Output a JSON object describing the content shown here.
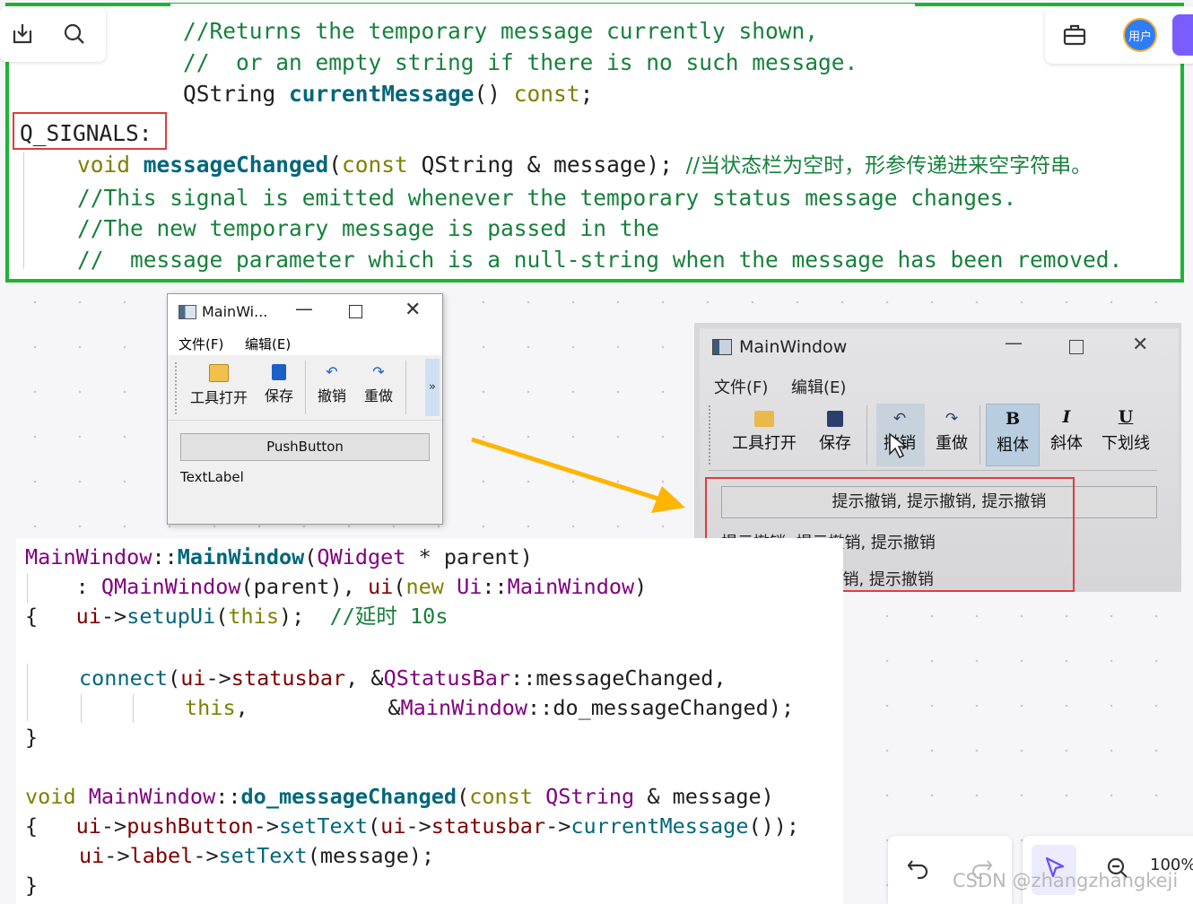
{
  "toolbar_left": {
    "icons": [
      "import-icon",
      "search-icon"
    ]
  },
  "toolbar_right": {
    "avatar_label": "用户"
  },
  "top_code": {
    "line1": "//Returns the temporary message currently shown,",
    "line2": "//  or an empty string if there is no such message.",
    "line3_type": "QString ",
    "line3_fn": "currentMessage",
    "line3_rest": "() ",
    "line3_const": "const",
    "line3_end": ";",
    "signals": "Q_SIGNALS:",
    "sig_void": "void ",
    "sig_fn": "messageChanged",
    "sig_paren": "(",
    "sig_const": "const",
    "sig_params": " QString & message); ",
    "sig_comment": "//当状态栏为空时，形参传递进来空字符串。",
    "c1": "//This signal is emitted whenever the temporary status message changes.",
    "c2": "//The new temporary message is passed in the",
    "c3": "//  message parameter which is a null-string when the message has been removed."
  },
  "window1": {
    "title": "MainWi...",
    "menu": [
      "文件(F)",
      "编辑(E)"
    ],
    "toolbar": [
      "工具打开",
      "保存",
      "撤销",
      "重做"
    ],
    "more": "»",
    "push_button": "PushButton",
    "label": "TextLabel"
  },
  "window2": {
    "title": "MainWindow",
    "menu": [
      "文件(F)",
      "编辑(E)"
    ],
    "toolbar": [
      "工具打开",
      "保存",
      "撤销",
      "重做",
      "粗体",
      "斜体",
      "下划线"
    ],
    "bold_glyph": "B",
    "italic_glyph": "I",
    "underline_glyph": "U",
    "button_text": "提示撤销, 提示撤销, 提示撤销",
    "label1": "提示撤销, 提示撤销, 提示撤销",
    "label2": "提示撤销, 提示撤销, 提示撤销"
  },
  "bottom_code": {
    "l1_cls": "MainWindow",
    "l1_sep": "::",
    "l1_fn": "MainWindow",
    "l1_paren": "(",
    "l1_type": "QWidget",
    "l1_rest": " * parent)",
    "l2_colon": "  : ",
    "l2_base": "QMainWindow",
    "l2_mid": "(parent), ",
    "l2_ui": "ui",
    "l2_paren": "(",
    "l2_new": "new",
    "l2_space": " ",
    "l2_ns": "Ui",
    "l2_sep": "::",
    "l2_cls": "MainWindow",
    "l2_end": ")",
    "l3_brace": "{   ",
    "l3_ui": "ui",
    "l3_arrow": "->",
    "l3_fn": "setupUi",
    "l3_paren": "(",
    "l3_this": "this",
    "l3_end": ");  ",
    "l3_comment": "//延时 10s",
    "l4_fn": "connect",
    "l4_paren": "(",
    "l4_ui": "ui",
    "l4_arrow": "->",
    "l4_mem": "statusbar",
    "l4_comma": ", &",
    "l4_cls": "QStatusBar",
    "l4_sep": "::",
    "l4_sig": "messageChanged",
    "l4_end": ",",
    "l5_this": "this",
    "l5_mid": ",           &",
    "l5_cls": "MainWindow",
    "l5_sep": "::",
    "l5_slot": "do_messageChanged",
    "l5_end": ");",
    "l6_brace": "}",
    "l7_void": "void ",
    "l7_cls": "MainWindow",
    "l7_sep": "::",
    "l7_fn": "do_messageChanged",
    "l7_paren": "(",
    "l7_const": "const",
    "l7_space": " ",
    "l7_type": "QString",
    "l7_rest": " & message)",
    "l8_brace": "{   ",
    "l8_ui": "ui",
    "l8_arrow": "->",
    "l8_mem": "pushButton",
    "l8_arrow2": "->",
    "l8_fn": "setText",
    "l8_paren": "(",
    "l8_ui2": "ui",
    "l8_arrow3": "->",
    "l8_mem2": "statusbar",
    "l8_arrow4": "->",
    "l8_fn2": "currentMessage",
    "l8_end": "());",
    "l9_ui": "ui",
    "l9_arrow": "->",
    "l9_mem": "label",
    "l9_arrow2": "->",
    "l9_fn": "setText",
    "l9_end": "(message);",
    "l10_brace": "}"
  },
  "zoom_control": {
    "zoom": "100%"
  },
  "watermark": "CSDN @zhangzhangkeji",
  "colors": {
    "frame_green": "#1fb336",
    "highlight_red": "#e03c3c",
    "arrow_orange": "#ffb400",
    "arrow_red": "#e52222",
    "accent_purple": "#7b5cff"
  }
}
